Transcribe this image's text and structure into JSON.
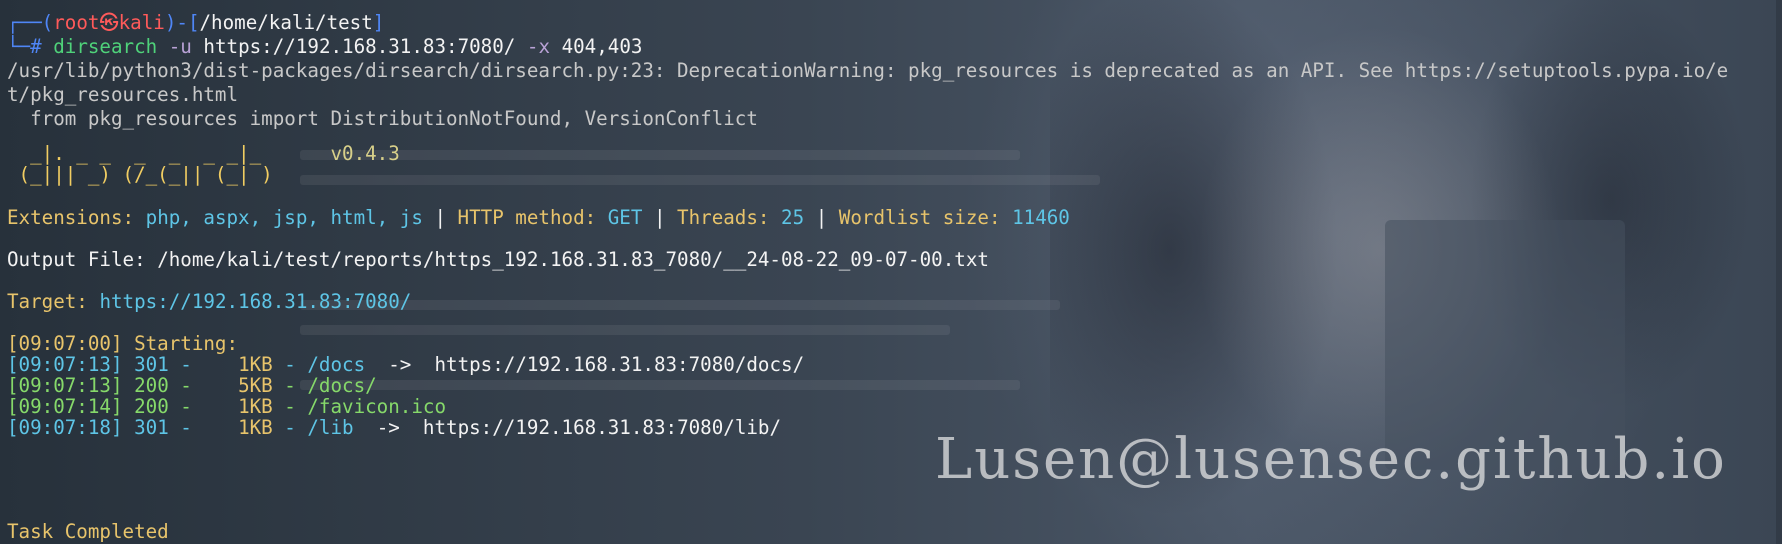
{
  "prompt": {
    "open": "┌──(",
    "user": "root",
    "sym": "㉿",
    "host": "kali",
    "mid": ")-[",
    "path": "/home/kali/test",
    "close": "]",
    "hash": "└─#"
  },
  "command": {
    "bin": "dirsearch",
    "flag_u": "-u",
    "url": "https://192.168.31.83:7080/",
    "flag_x": "-x",
    "codes": "404,403"
  },
  "warning": {
    "line1": "/usr/lib/python3/dist-packages/dirsearch/dirsearch.py:23: DeprecationWarning: pkg_resources is deprecated as an API. See https://setuptools.pypa.io/e",
    "line2": "t/pkg_resources.html",
    "line3": "  from pkg_resources import DistributionNotFound, VersionConflict"
  },
  "banner": {
    "row1": "  _|. _ _  _  _  _ _|_",
    "row2": " (_||| _) (/_(_|| (_| )",
    "version": "v0.4.3"
  },
  "config": {
    "ext_label": "Extensions:",
    "ext_value": "php, aspx, jsp, html, js",
    "method_label": "HTTP method:",
    "method_value": "GET",
    "threads_label": "Threads:",
    "threads_value": "25",
    "wordlist_label": "Wordlist size:",
    "wordlist_value": "11460",
    "sep": " | "
  },
  "output": {
    "label": "Output File:",
    "path": "/home/kali/test/reports/https_192.168.31.83_7080/__24-08-22_09-07-00.txt"
  },
  "target": {
    "label": "Target:",
    "url": "https://192.168.31.83:7080/"
  },
  "starting": "[09:07:00] Starting:",
  "results": [
    {
      "time": "[09:07:13]",
      "status": "301",
      "size": "1KB",
      "path": "/docs",
      "redirect": "https://192.168.31.83:7080/docs/"
    },
    {
      "time": "[09:07:13]",
      "status": "200",
      "size": "5KB",
      "path": "/docs/",
      "redirect": ""
    },
    {
      "time": "[09:07:14]",
      "status": "200",
      "size": "1KB",
      "path": "/favicon.ico",
      "redirect": ""
    },
    {
      "time": "[09:07:18]",
      "status": "301",
      "size": "1KB",
      "path": "/lib",
      "redirect": "https://192.168.31.83:7080/lib/"
    }
  ],
  "result_sep": " - ",
  "arrow": "->",
  "task": "Task Completed",
  "watermark": "Lusen@lusensec.github.io"
}
